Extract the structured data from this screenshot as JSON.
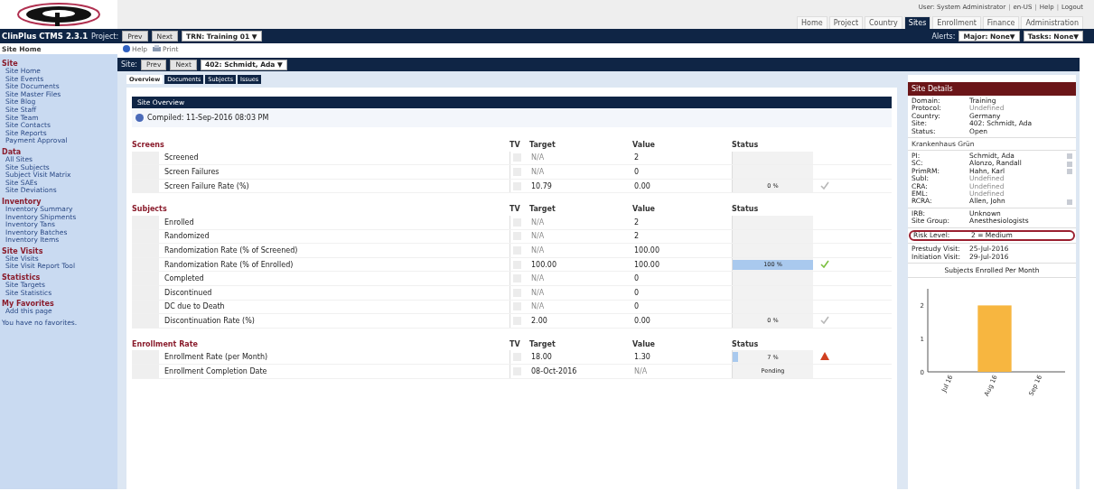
{
  "user_bar": [
    "User: System Administrator",
    "en-US",
    "Help",
    "Logout"
  ],
  "user_bar_separator": "|",
  "main_tabs": [
    {
      "label": "Home",
      "selected": false
    },
    {
      "label": "Project",
      "selected": false
    },
    {
      "label": "Country",
      "selected": false
    },
    {
      "label": "Sites",
      "selected": true
    },
    {
      "label": "Enrollment",
      "selected": false
    },
    {
      "label": "Finance",
      "selected": false
    },
    {
      "label": "Administration",
      "selected": false
    }
  ],
  "app_title": "ClinPlus CTMS 2.3.1",
  "project_label": "Project:",
  "project_buttons": [
    "Prev",
    "Next"
  ],
  "project_select": "TRN: Training 01 ▼",
  "alerts_label": "Alerts:",
  "alert_selects": [
    "Major: None▼",
    "Tasks: None▼"
  ],
  "breadcrumb": "Site Home",
  "tools": [
    "Help",
    "Print"
  ],
  "sidebar": [
    {
      "title": "Site",
      "items": [
        "Site Home",
        "Site Events",
        "Site Documents",
        "Site Master Files",
        "Site Blog",
        "Site Staff",
        "Site Team",
        "Site Contacts",
        "Site Reports",
        "Payment Approval"
      ]
    },
    {
      "title": "Data",
      "items": [
        "All Sites",
        "Site Subjects",
        "Subject Visit Matrix",
        "Site SAEs",
        "Site Deviations"
      ]
    },
    {
      "title": "Inventory",
      "items": [
        "Inventory Summary",
        "Inventory Shipments",
        "Inventory Tans",
        "Inventory Batches",
        "Inventory Items"
      ]
    },
    {
      "title": "Site Visits",
      "items": [
        "Site Visits",
        "Site Visit Report Tool"
      ]
    },
    {
      "title": "Statistics",
      "items": [
        "Site Targets",
        "Site Statistics"
      ]
    },
    {
      "title": "My Favorites",
      "items": [
        "Add this page"
      ]
    }
  ],
  "favorites_note": "You have no favorites.",
  "site_label": "Site:",
  "site_buttons": [
    "Prev",
    "Next"
  ],
  "site_select": "402: Schmidt, Ada ▼",
  "content_tabs": [
    {
      "label": "Overview",
      "selected": true
    },
    {
      "label": "Documents",
      "selected": false
    },
    {
      "label": "Subjects",
      "selected": false
    },
    {
      "label": "Issues",
      "selected": false
    }
  ],
  "overview_title": "Site Overview",
  "compiled": "Compiled: 11-Sep-2016 08:03 PM",
  "sections": [
    {
      "title": "Screens",
      "headers": [
        "TV",
        "Target",
        "Value",
        "Status"
      ],
      "rows": [
        {
          "label": "Screened",
          "tv_checked": false,
          "target": "N/A",
          "target_muted": true,
          "value": "2",
          "value_muted": false
        },
        {
          "label": "Screen Failures",
          "tv_checked": false,
          "target": "N/A",
          "target_muted": true,
          "value": "0",
          "value_muted": false
        },
        {
          "label": "Screen Failure Rate (%)",
          "tv_checked": false,
          "target": "10.79",
          "target_muted": false,
          "value": "0.00",
          "value_muted": false,
          "status": "0 %",
          "level": 0,
          "status_icon": {
            "kind": "check_grey"
          }
        }
      ]
    },
    {
      "title": "Subjects",
      "headers": [
        "TV",
        "Target",
        "Value",
        "Status"
      ],
      "rows": [
        {
          "label": "Enrolled",
          "tv_checked": false,
          "target": "N/A",
          "target_muted": true,
          "value": "2",
          "value_muted": false
        },
        {
          "label": "Randomized",
          "tv_checked": false,
          "target": "N/A",
          "target_muted": true,
          "value": "2",
          "value_muted": false
        },
        {
          "label": "Randomization Rate (% of Screened)",
          "tv_checked": false,
          "target": "N/A",
          "target_muted": true,
          "value": "100.00",
          "value_muted": false
        },
        {
          "label": "Randomization Rate (% of Enrolled)",
          "tv_checked": false,
          "target": "100.00",
          "target_muted": false,
          "value": "100.00",
          "value_muted": false,
          "status": "100 %",
          "level": 1,
          "status_icon": {
            "kind": "check_green"
          }
        },
        {
          "label": "Completed",
          "tv_checked": false,
          "target": "N/A",
          "target_muted": true,
          "value": "0",
          "value_muted": false
        },
        {
          "label": "Discontinued",
          "tv_checked": false,
          "target": "N/A",
          "target_muted": true,
          "value": "0",
          "value_muted": false
        },
        {
          "label": "DC due to Death",
          "tv_checked": false,
          "target": "N/A",
          "target_muted": true,
          "value": "0",
          "value_muted": false
        },
        {
          "label": "Discontinuation Rate (%)",
          "tv_checked": false,
          "target": "2.00",
          "target_muted": false,
          "value": "0.00",
          "value_muted": false,
          "status": "0 %",
          "level": 0,
          "status_icon": {
            "kind": "check_grey"
          }
        }
      ]
    },
    {
      "title": "Enrollment Rate",
      "headers": [
        "TV",
        "Target",
        "Value",
        "Status"
      ],
      "rows": [
        {
          "label": "Enrollment Rate (per Month)",
          "tv_checked": false,
          "target": "18.00",
          "target_muted": false,
          "value": "1.30",
          "value_muted": false,
          "status": "7 %",
          "level": 0.07,
          "status_icon": {
            "kind": "warning"
          }
        },
        {
          "label": "Enrollment Completion Date",
          "tv_checked": false,
          "target": "08-Oct-2016",
          "target_muted": false,
          "value": "N/A",
          "value_muted": true,
          "status": "Pending"
        }
      ]
    }
  ],
  "site_details": {
    "title": "Site Details",
    "groups": [
      {
        "rows": [
          {
            "label": "Domain:",
            "value": "Training",
            "muted": false
          },
          {
            "label": "Protocol:",
            "value": "Undefined",
            "muted": true
          },
          {
            "label": "Country:",
            "value": "Germany",
            "muted": false
          },
          {
            "label": "Site:",
            "value": "402: Schmidt, Ada",
            "muted": false
          },
          {
            "label": "Status:",
            "value": "Open",
            "muted": false
          }
        ]
      },
      {
        "heading": "Krankenhaus Grün"
      },
      {
        "rows": [
          {
            "label": "PI:",
            "value": "Schmidt, Ada",
            "muted": false,
            "contact": true
          },
          {
            "label": "SC:",
            "value": "Alonzo, Randall",
            "muted": false,
            "contact": true
          },
          {
            "label": "PrimRM:",
            "value": "Hahn, Karl",
            "muted": false,
            "contact": true
          },
          {
            "label": "SubI:",
            "value": "Undefined",
            "muted": true
          },
          {
            "label": "CRA:",
            "value": "Undefined",
            "muted": true
          },
          {
            "label": "EML:",
            "value": "Undefined",
            "muted": true
          },
          {
            "label": "RCRA:",
            "value": "Allen, John",
            "muted": false,
            "contact": true
          }
        ]
      },
      {
        "rows": [
          {
            "label": "IRB:",
            "value": "Unknown",
            "muted": false
          },
          {
            "label": "Site Group:",
            "value": "Anesthesiologists",
            "muted": false
          }
        ]
      },
      {
        "rows": [
          {
            "label": "Risk Level:",
            "value": "2 = Medium",
            "muted": false,
            "highlighted": true
          }
        ]
      },
      {
        "rows": [
          {
            "label": "Prestudy Visit:",
            "value": "25-Jul-2016",
            "muted": false
          },
          {
            "label": "Initiation Visit:",
            "value": "29-Jul-2016",
            "muted": false
          }
        ]
      }
    ],
    "chart_data": {
      "type": "bar",
      "title": "Subjects Enrolled Per Month",
      "categories": [
        "Jul 16",
        "Aug 16",
        "Sep 16"
      ],
      "values": [
        0,
        2,
        0
      ],
      "ylim": [
        0,
        2.5
      ],
      "yticks": [
        0,
        1,
        2
      ]
    }
  }
}
